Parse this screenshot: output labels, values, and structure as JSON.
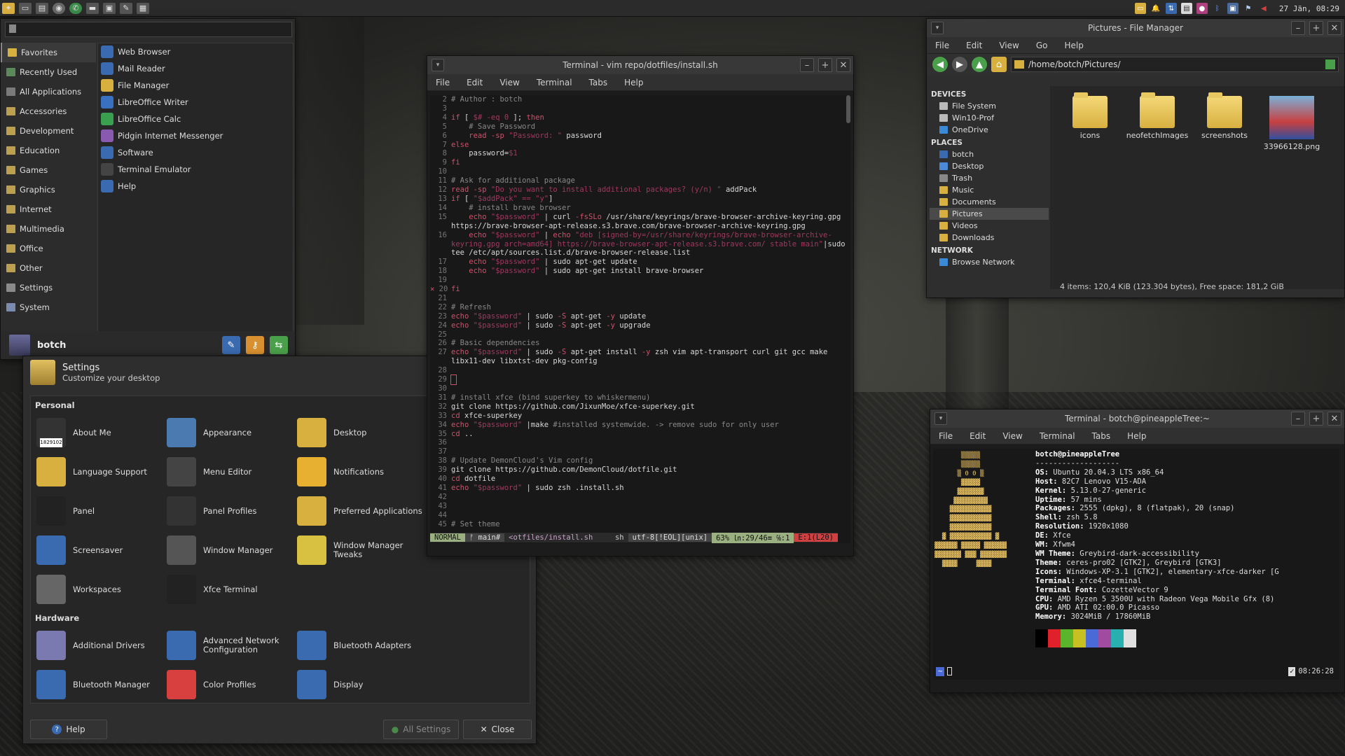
{
  "top_panel": {
    "launchers": [
      "app-menu-icon",
      "folder-icon",
      "files-icon",
      "browser-icon",
      "whatsapp-icon",
      "terminal-icon",
      "window-icon",
      "editor-icon",
      "screen-icon"
    ],
    "clock": "27 Jän, 08:29"
  },
  "whisker": {
    "categories": [
      "Favorites",
      "Recently Used",
      "All Applications",
      "Accessories",
      "Development",
      "Education",
      "Games",
      "Graphics",
      "Internet",
      "Multimedia",
      "Office",
      "Other",
      "Settings",
      "System"
    ],
    "apps": [
      "Web Browser",
      "Mail Reader",
      "File Manager",
      "LibreOffice Writer",
      "LibreOffice Calc",
      "Pidgin Internet Messenger",
      "Software",
      "Terminal Emulator",
      "Help"
    ],
    "username": "botch"
  },
  "settings": {
    "title": "Settings",
    "subtitle": "Customize your desktop",
    "section_personal": "Personal",
    "personal": [
      "About Me",
      "Appearance",
      "Desktop",
      "Language Support",
      "Menu Editor",
      "Notifications",
      "Panel",
      "Panel Profiles",
      "Preferred Applications",
      "Screensaver",
      "Window Manager",
      "Window Manager Tweaks",
      "Workspaces",
      "Xfce Terminal"
    ],
    "about_me_badge": "1829102",
    "section_hardware": "Hardware",
    "hardware": [
      "Additional Drivers",
      "Advanced Network Configuration",
      "Bluetooth Adapters",
      "Bluetooth Manager",
      "Color Profiles",
      "Display"
    ],
    "help": "Help",
    "all_settings": "All Settings",
    "close": "Close"
  },
  "term1": {
    "title": "Terminal - vim repo/dotfiles/install.sh",
    "menu": [
      "File",
      "Edit",
      "View",
      "Terminal",
      "Tabs",
      "Help"
    ],
    "status": {
      "mode": "NORMAL",
      "branch": "ᚠ main#",
      "file": "<otfiles/install.sh",
      "ft": "sh",
      "enc": "utf-8[!EOL][unix]",
      "pos": "63% ㏑:29/46≡ ℅:1",
      "err": "E:1(L20)"
    }
  },
  "fm": {
    "title": "Pictures - File Manager",
    "menu": [
      "File",
      "Edit",
      "View",
      "Go",
      "Help"
    ],
    "path": "/home/botch/Pictures/",
    "devices_h": "DEVICES",
    "devices": [
      "File System",
      "Win10-Prof",
      "OneDrive"
    ],
    "places_h": "PLACES",
    "places": [
      "botch",
      "Desktop",
      "Trash",
      "Music",
      "Documents",
      "Pictures",
      "Videos",
      "Downloads"
    ],
    "network_h": "NETWORK",
    "network": [
      "Browse Network"
    ],
    "files": [
      "icons",
      "neofetchImages",
      "screenshots",
      "33966128.png"
    ],
    "status": "4 items: 120,4 KiB (123.304 bytes), Free space: 181,2 GiB"
  },
  "term2": {
    "title": "Terminal - botch@pineappleTree:~",
    "menu": [
      "File",
      "Edit",
      "View",
      "Terminal",
      "Tabs",
      "Help"
    ],
    "user": "botch@pineappleTree",
    "sep": "-------------------",
    "info": [
      [
        "OS:",
        " Ubuntu 20.04.3 LTS x86_64"
      ],
      [
        "Host:",
        " 82C7 Lenovo V15-ADA"
      ],
      [
        "Kernel:",
        " 5.13.0-27-generic"
      ],
      [
        "Uptime:",
        " 57 mins"
      ],
      [
        "Packages:",
        " 2555 (dpkg), 8 (flatpak), 20 (snap)"
      ],
      [
        "Shell:",
        " zsh 5.8"
      ],
      [
        "Resolution:",
        " 1920x1080"
      ],
      [
        "DE:",
        " Xfce"
      ],
      [
        "WM:",
        " Xfwm4"
      ],
      [
        "WM Theme:",
        " Greybird-dark-accessibility"
      ],
      [
        "Theme:",
        " ceres-pro02 [GTK2], Greybird [GTK3]"
      ],
      [
        "Icons:",
        " Windows-XP-3.1 [GTK2], elementary-xfce-darker [G"
      ],
      [
        "Terminal:",
        " xfce4-terminal"
      ],
      [
        "Terminal Font:",
        " CozetteVector 9"
      ],
      [
        "CPU:",
        " AMD Ryzen 5 3500U with Radeon Vega Mobile Gfx (8)"
      ],
      [
        "GPU:",
        " AMD ATI 02:00.0 Picasso"
      ],
      [
        "Memory:",
        " 3024MiB / 17860MiB"
      ]
    ],
    "palette": [
      "#000000",
      "#e0202a",
      "#5ab52a",
      "#c8c020",
      "#4a6ad8",
      "#a04aa0",
      "#28b0b0",
      "#e0e0e0"
    ],
    "time": "08:26:28"
  }
}
